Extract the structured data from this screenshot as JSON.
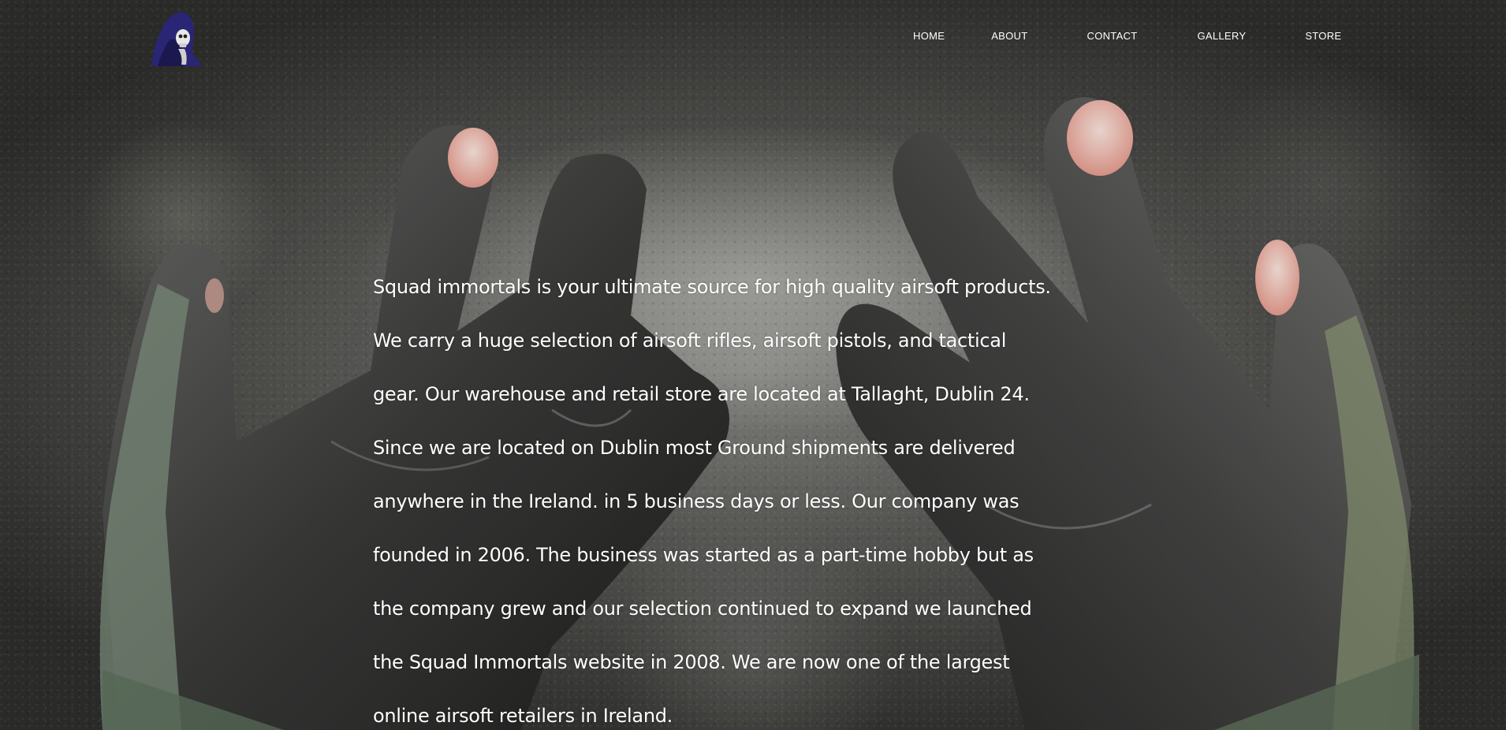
{
  "logo": {
    "icon": "hooded-skull-icon",
    "colors": {
      "hood": "#2a2575",
      "skull": "#e8e8e8"
    }
  },
  "nav": {
    "items": [
      {
        "label": "HOME"
      },
      {
        "label": "ABOUT"
      },
      {
        "label": "CONTACT"
      },
      {
        "label": "GALLERY"
      },
      {
        "label": "STORE"
      }
    ]
  },
  "about": {
    "lines": [
      "Squad immortals is your ultimate source for high quality airsoft products.",
      "We carry a huge selection of airsoft rifles, airsoft pistols, and tactical",
      "gear. Our warehouse and retail store are located at Tallaght, Dublin 24.",
      "Since we are located on Dublin most Ground shipments are delivered",
      "anywhere in the Ireland. in 5 business days or less. Our company was",
      "founded in 2006. The business was started as a part-time hobby but as",
      "the company grew and our selection continued to expand we launched",
      "the Squad Immortals website in 2008. We are now one of the largest",
      "online airsoft retailers in Ireland."
    ]
  },
  "hero": {
    "image": "worn-tactical-gloves-background"
  }
}
